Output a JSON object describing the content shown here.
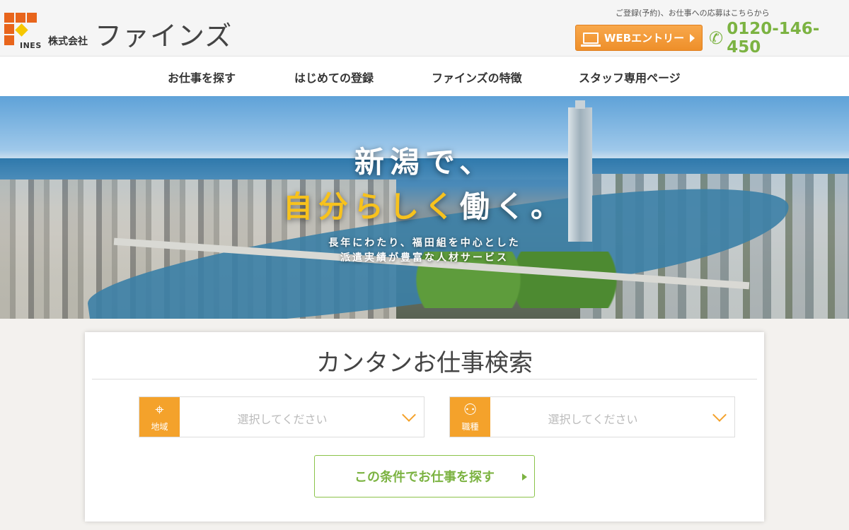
{
  "header": {
    "logo_corp": "株式会社",
    "logo_name": "ファインズ",
    "logo_mark_text": "INES",
    "registration_note": "ご登録(予約)、お仕事への応募はこちらから",
    "web_entry_label": "WEBエントリー",
    "phone": "0120-146-450"
  },
  "nav": {
    "items": [
      {
        "label": "お仕事を探す"
      },
      {
        "label": "はじめての登録"
      },
      {
        "label": "ファインズの特徴"
      },
      {
        "label": "スタッフ専用ページ"
      }
    ]
  },
  "hero": {
    "line1": "新潟で、",
    "line2_highlight": "自分らしく",
    "line2_rest": "働く。",
    "sub1": "長年にわたり、福田組を中心とした",
    "sub2": "派遣実績が豊富な人材サービス"
  },
  "search": {
    "title": "カンタンお仕事検索",
    "area": {
      "icon_label": "地域",
      "placeholder": "選択してください",
      "icon": "map-pin-icon"
    },
    "job": {
      "icon_label": "職種",
      "placeholder": "選択してください",
      "icon": "worker-icon"
    },
    "button_label": "この条件でお仕事を探す"
  },
  "colors": {
    "accent_orange": "#f4a22b",
    "accent_green": "#7cb342",
    "highlight_yellow": "#f7c21d"
  }
}
